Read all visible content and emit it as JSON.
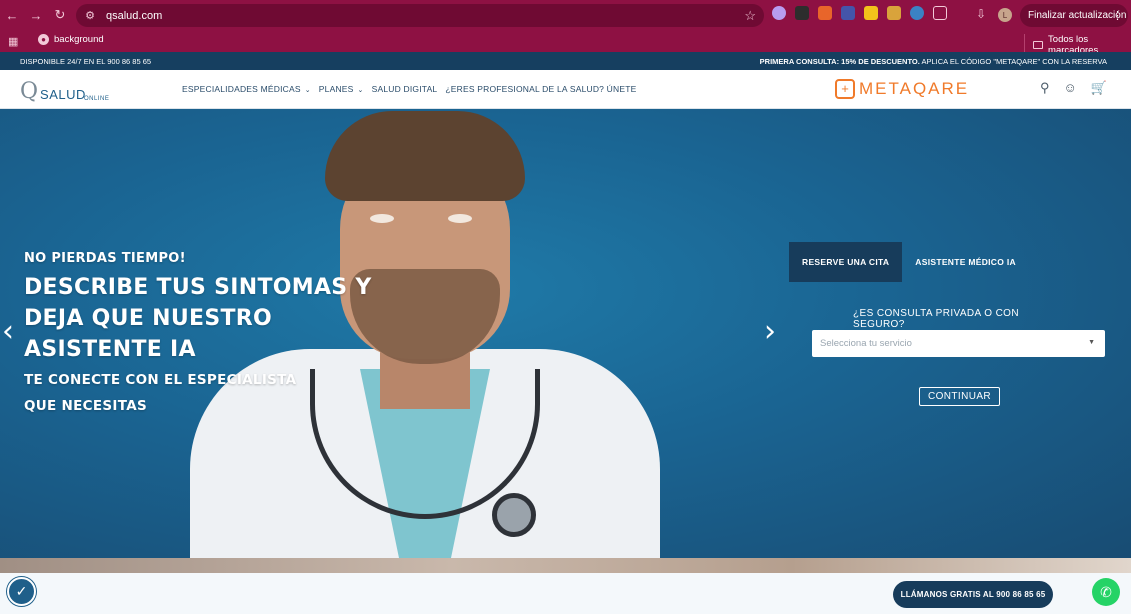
{
  "browser": {
    "url": "qsalud.com",
    "bookmark": "background",
    "bookmarks_right": "Todos los marcadores",
    "update_button": "Finalizar actualización",
    "avatar_letter": "L"
  },
  "topbar": {
    "left": "DISPONIBLE 24/7 EN EL 900 86 85 65",
    "promo_bold": "PRIMERA CONSULTA: 15% DE DESCUENTO.",
    "promo_rest": "APLICA EL CÓDIGO \"METAQARE\" CON LA RESERVA"
  },
  "header": {
    "logo_brand": "SALUD",
    "logo_sub": "ONLINE",
    "menu": [
      {
        "label": "ESPECIALIDADES MÉDICAS"
      },
      {
        "label": "PLANES"
      },
      {
        "label": "SALUD DIGITAL"
      },
      {
        "label": "¿ERES PROFESIONAL DE LA SALUD? ÚNETE"
      }
    ],
    "partner": "METAQARE"
  },
  "hero": {
    "kicker": "NO PIERDAS TIEMPO!",
    "headline": "DESCRIBE TUS SINTOMAS Y DEJA QUE NUESTRO ASISTENTE IA",
    "sub": "TE CONECTE CON EL ESPECIALISTA QUE NECESITAS"
  },
  "booking": {
    "tabs": [
      {
        "label": "RESERVE UNA CITA"
      },
      {
        "label": "ASISTENTE MÉDICO IA"
      }
    ],
    "question": "¿ES CONSULTA PRIVADA O CON SEGURO?",
    "select_placeholder": "Selecciona tu servicio",
    "continue": "CONTINUAR"
  },
  "footer": {
    "call_button": "LLÁMANOS GRATIS AL 900 86 85 65"
  },
  "colors": {
    "chrome": "#8e1143",
    "topbar": "#163f60",
    "hero": "#1a6492",
    "partner": "#f07a2a",
    "whatsapp": "#25d366"
  }
}
